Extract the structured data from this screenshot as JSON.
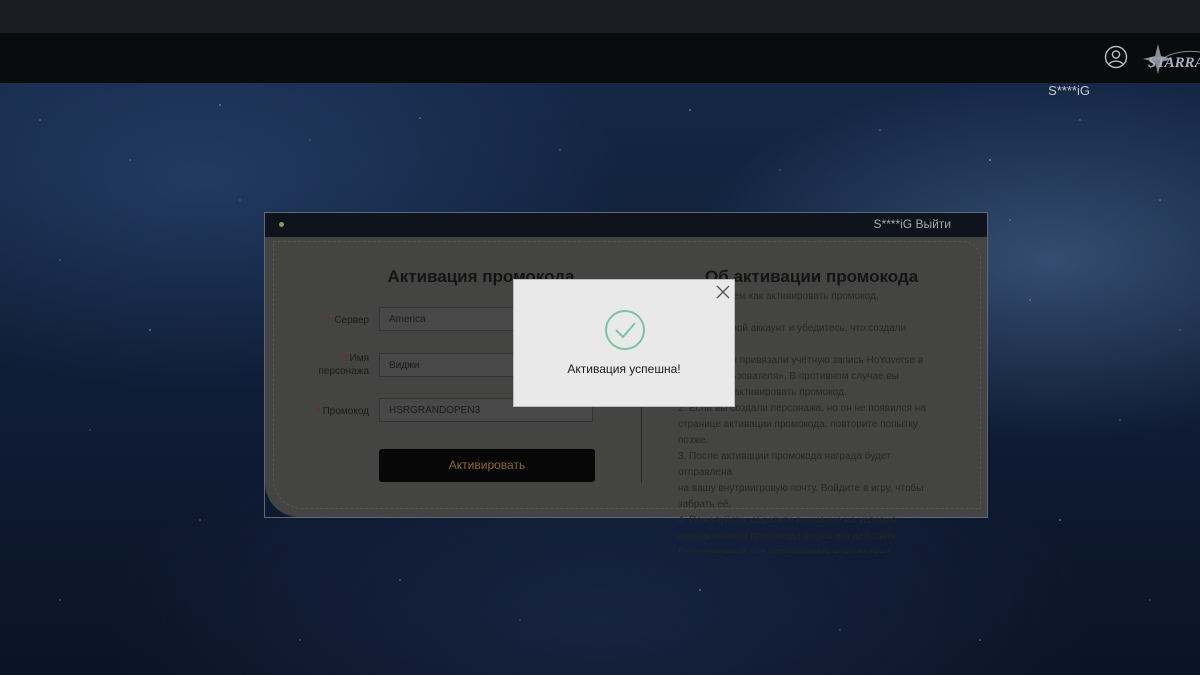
{
  "header": {
    "username": "S****iG",
    "user_icon": "user-circle-icon",
    "logo_icon": "honkai-star-rail-logo"
  },
  "panel": {
    "header_user": "S****iG Выйти",
    "form": {
      "title": "Активация промокода",
      "server_label": "Сервер",
      "server_value": "America",
      "character_label_line1": "Имя",
      "character_label_line2": "персонажа",
      "character_value": "Виджи",
      "promo_label": "Промокод",
      "promo_value": "HSRGRANDOPEN3",
      "submit_label": "Активировать",
      "required_mark": "*"
    },
    "info": {
      "title": "Об активации промокода",
      "lines": [
        "1. Прежде чем как активировать промокод, пожалуйста,",
        "войдите в свой аккаунт и убедитесь, что создали игрового",
        "персонажа и привязали учётную запись HoYoverse в",
        "«Центр пользователя». В противном случае вы",
        "не сможете активировать промокод.",
        "2. Если вы создали персонажа, но он не появился на",
        "странице активации промокода, повторите попытку позже.",
        "3. После активации промокода награда будет отправлена",
        "на вашу внутриигровую почту. Войдите в игру, чтобы",
        "забрать её.",
        "4. Пожалуйста, обратите внимание на условия",
        "использования промокода и срок его действия.",
        "Просроченный код активировать невозможно."
      ]
    }
  },
  "modal": {
    "message": "Активация успешна!",
    "close_icon": "close-icon",
    "status_icon": "check-circle-icon",
    "accent_color": "#7cc4a4"
  }
}
